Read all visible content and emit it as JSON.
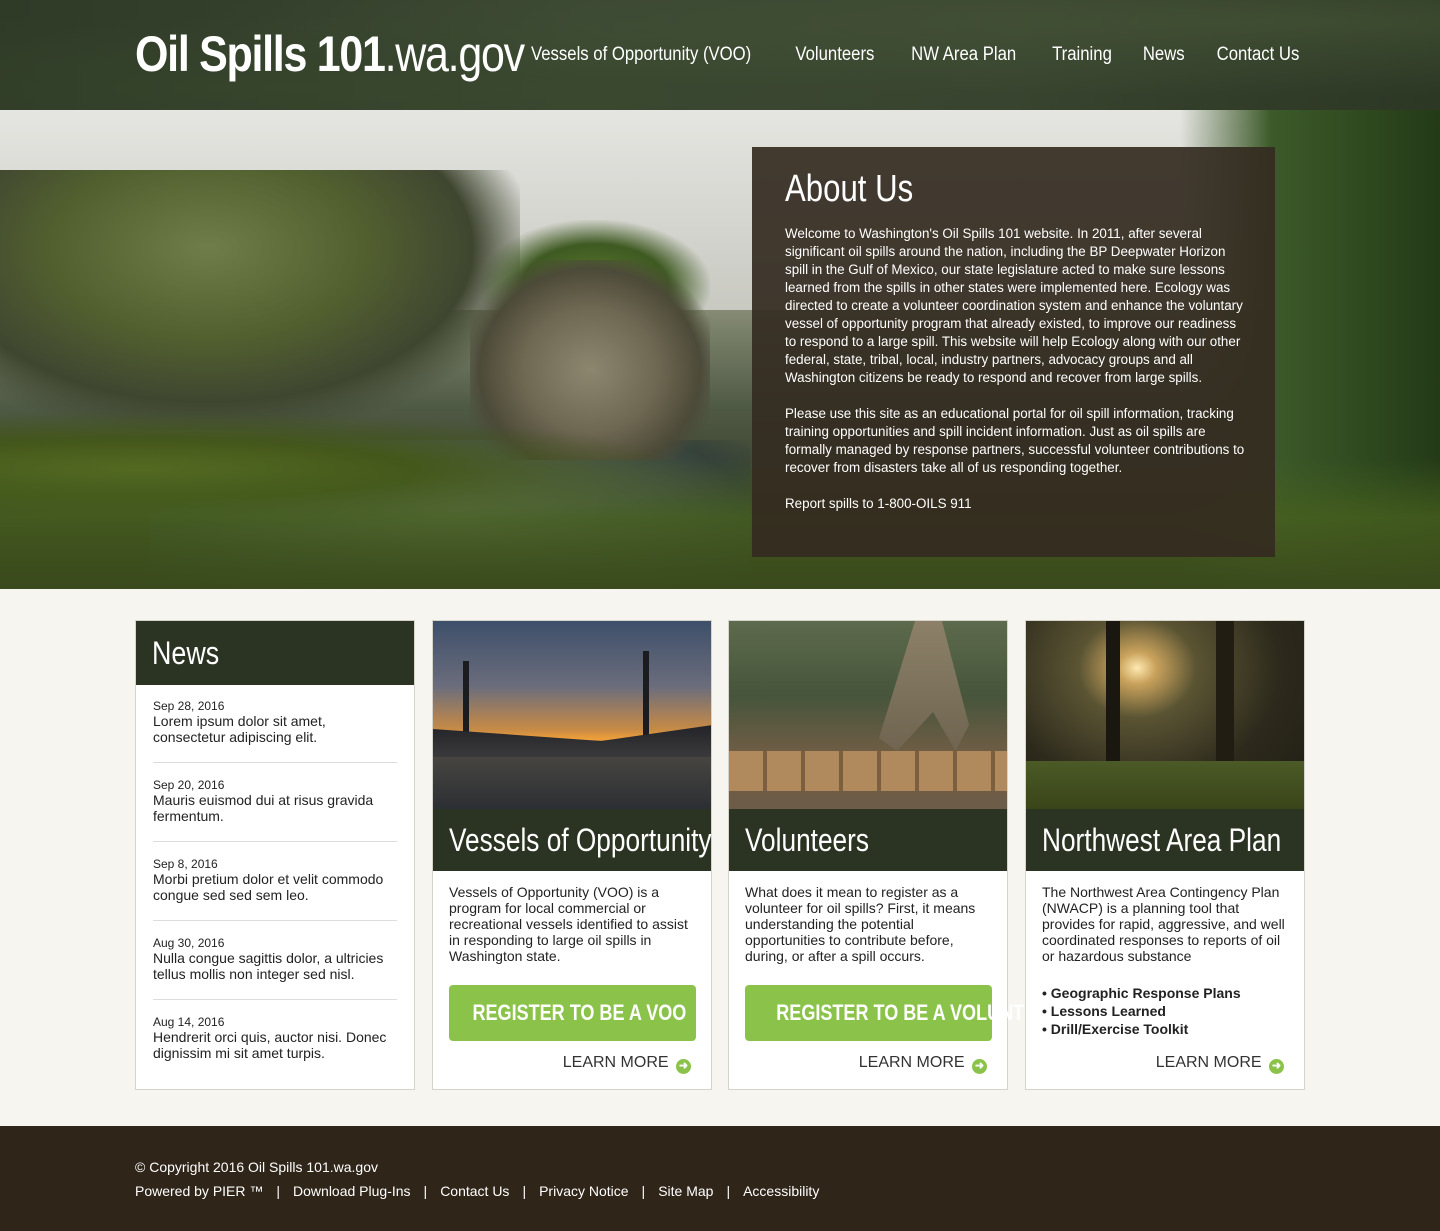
{
  "header": {
    "logo_bold": "Oil Spills 101",
    "logo_light": ".wa.gov",
    "nav": [
      "Vessels of Opportunity (VOO)",
      "Volunteers",
      "NW Area Plan",
      "Training",
      "News",
      "Contact Us"
    ]
  },
  "about": {
    "title": "About Us",
    "p1": "Welcome to Washington's Oil Spills 101 website. In 2011, after several significant oil spills around the nation, including the BP Deepwater Horizon spill in the Gulf of Mexico, our state legislature acted to make sure lessons learned from the spills in other states were implemented here.  Ecology was directed to create a volunteer coordination system and enhance the voluntary vessel of opportunity program that already existed, to improve our readiness to respond to a large spill. This website will help Ecology along with our other federal, state, tribal, local, industry partners, advocacy groups and all Washington citizens be ready to respond and recover from large spills.",
    "p2": "Please use this site as an educational portal for oil spill information, tracking training opportunities and spill incident information.  Just as oil spills are formally managed by response partners, successful volunteer contributions to recover from disasters take all of us responding together.",
    "p3": "Report spills to 1-800-OILS 911"
  },
  "news": {
    "title": "News",
    "items": [
      {
        "date": "Sep 28, 2016",
        "text": "Lorem ipsum dolor sit amet, consectetur adipiscing elit."
      },
      {
        "date": "Sep 20, 2016",
        "text": "Mauris euismod dui at risus gravida fermentum."
      },
      {
        "date": "Sep 8, 2016",
        "text": "Morbi pretium dolor et velit commodo congue sed sed sem leo."
      },
      {
        "date": "Aug 30, 2016",
        "text": "Nulla congue sagittis dolor, a ultricies tellus mollis non integer sed nisl."
      },
      {
        "date": "Aug 14, 2016",
        "text": "Hendrerit orci quis, auctor nisi. Donec dignissim mi sit amet turpis."
      }
    ]
  },
  "cards": {
    "voo": {
      "title": "Vessels of Opportunity",
      "body": "Vessels of Opportunity (VOO) is a program for local commercial or recreational vessels identified to assist in responding to large oil spills in Washington state.",
      "button": "REGISTER TO BE A VOO",
      "learn": "LEARN MORE"
    },
    "volunteers": {
      "title": "Volunteers",
      "body": "What does it mean to register as a volunteer for oil spills? First, it means understanding the potential opportunities to contribute before, during, or after a spill occurs.",
      "button": "REGISTER TO BE A VOLUNTEER",
      "learn": "LEARN MORE"
    },
    "nwap": {
      "title": "Northwest Area Plan",
      "body": "The Northwest Area Contingency Plan (NWACP) is a planning tool that provides for rapid, aggressive, and well coordinated responses to reports of oil or hazardous substance",
      "bullets": [
        "• Geographic Response Plans",
        "• Lessons Learned",
        "• Drill/Exercise Toolkit"
      ],
      "learn": "LEARN MORE"
    }
  },
  "footer": {
    "copyright": "© Copyright 2016 Oil Spills 101.wa.gov",
    "links": [
      "Powered by PIER ™",
      "Download Plug-Ins",
      "Contact Us",
      "Privacy Notice",
      "Site Map",
      "Accessibility"
    ],
    "separator": "|"
  },
  "colors": {
    "header_bg": "#2f3a27",
    "dark_green": "#2b3322",
    "accent_green": "#8bc34a",
    "about_bg": "#342b21",
    "footer_bg": "#2f2519",
    "page_bg": "#f7f5f0"
  },
  "icons": {
    "learn_more_arrow": "arrow-right-circle-icon"
  }
}
